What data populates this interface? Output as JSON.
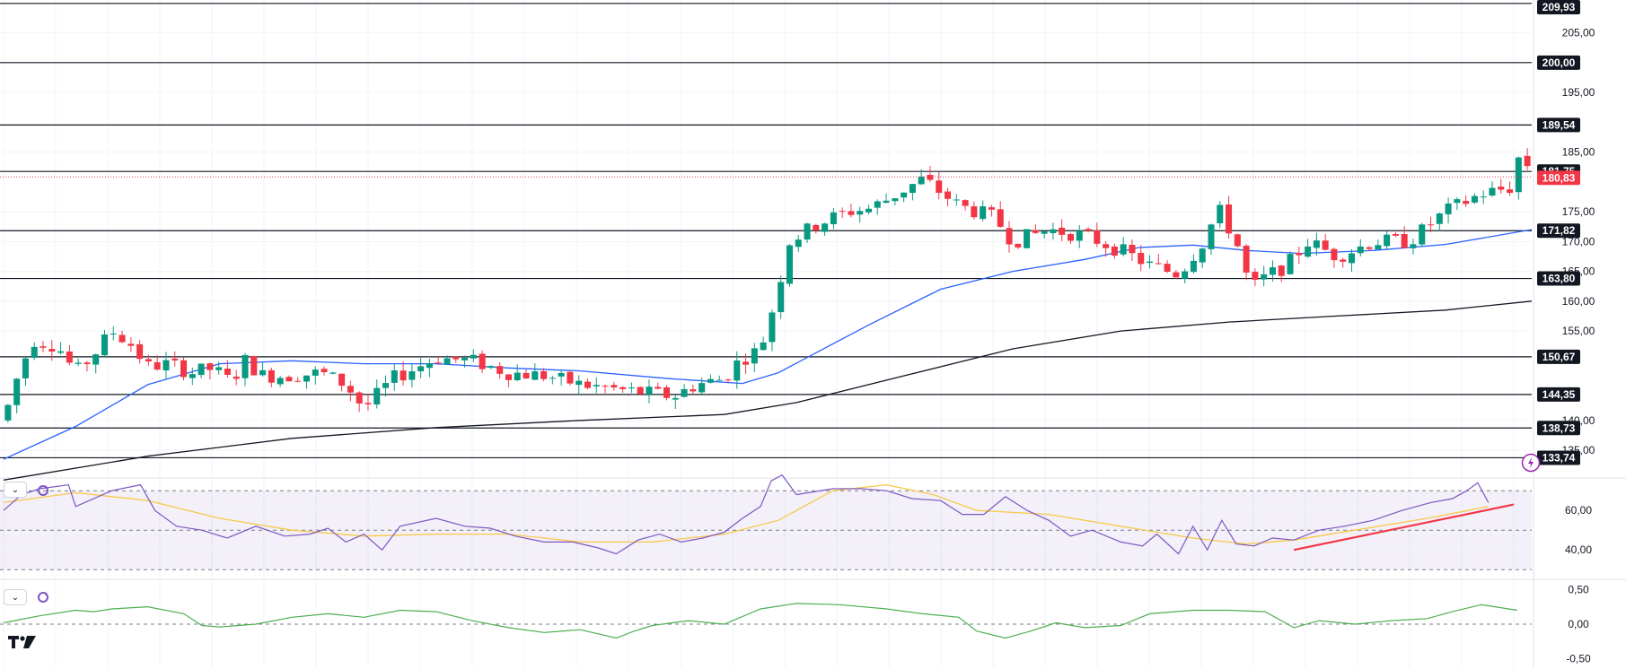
{
  "colors": {
    "bull": "#089981",
    "bear": "#f23645",
    "ema50": "#2962ff",
    "ema200": "#131722",
    "rsi": "#7e57c2",
    "rsi_ma": "#f7c948",
    "rsi_band": "#7e57c2",
    "cmf": "#4caf50",
    "trendline": "#f23645",
    "last_price": "#f23645"
  },
  "icons": [
    "chevron-down-icon",
    "refresh-icon",
    "lightning-icon",
    "tradingview-logo"
  ],
  "chart_data": [
    {
      "type": "candlestick",
      "title": "",
      "y_axis_side": "right",
      "ylim": [
        130.5,
        210.5
      ],
      "ticks": [
        "205,00",
        "195,00",
        "185,00",
        "175,00",
        "170,00",
        "165,00",
        "160,00",
        "155,00",
        "140,00",
        "135,00"
      ],
      "tick_values": [
        205,
        195,
        185,
        175,
        170,
        165,
        160,
        155,
        140,
        135
      ],
      "horizontal_levels": [
        {
          "value": 209.93,
          "label": "209,93"
        },
        {
          "value": 200.0,
          "label": "200,00"
        },
        {
          "value": 189.54,
          "label": "189,54"
        },
        {
          "value": 181.75,
          "label": "181,75"
        },
        {
          "value": 171.82,
          "label": "171,82"
        },
        {
          "value": 163.8,
          "label": "163,80"
        },
        {
          "value": 150.67,
          "label": "150,67"
        },
        {
          "value": 144.35,
          "label": "144,35"
        },
        {
          "value": 138.73,
          "label": "138,73"
        },
        {
          "value": 133.74,
          "label": "133,74"
        }
      ],
      "last_price": {
        "value": 180.83,
        "label": "180,83"
      },
      "candle_count": 174,
      "close_path": [
        [
          0,
          140
        ],
        [
          3,
          146
        ],
        [
          8,
          153.5
        ],
        [
          15,
          152.5
        ],
        [
          20,
          148
        ],
        [
          25,
          151
        ],
        [
          30,
          155
        ],
        [
          35,
          153
        ],
        [
          40,
          149
        ],
        [
          46,
          149.5
        ],
        [
          52,
          148
        ],
        [
          58,
          148.7
        ],
        [
          63,
          146.5
        ],
        [
          67,
          150
        ],
        [
          72,
          147.5
        ],
        [
          80,
          147.5
        ],
        [
          88,
          148
        ],
        [
          95,
          146
        ],
        [
          100,
          142
        ],
        [
          108,
          147
        ],
        [
          115,
          149
        ],
        [
          120,
          150.5
        ],
        [
          130,
          150
        ],
        [
          140,
          148
        ],
        [
          150,
          147.5
        ],
        [
          160,
          146
        ],
        [
          170,
          145.2
        ],
        [
          180,
          144.5
        ],
        [
          186,
          144
        ],
        [
          192,
          146
        ],
        [
          200,
          147
        ],
        [
          204,
          150
        ],
        [
          210,
          152
        ],
        [
          214,
          160
        ],
        [
          218,
          170
        ],
        [
          226,
          173
        ],
        [
          234,
          175
        ],
        [
          240,
          175.5
        ],
        [
          245,
          177
        ],
        [
          255,
          180.5
        ],
        [
          265,
          176
        ],
        [
          275,
          174
        ],
        [
          280,
          170
        ],
        [
          290,
          172
        ],
        [
          300,
          171
        ],
        [
          310,
          168.5
        ],
        [
          318,
          166
        ],
        [
          326,
          164.5
        ],
        [
          333,
          170
        ],
        [
          337,
          175.5
        ],
        [
          342,
          170
        ],
        [
          346,
          162
        ],
        [
          350,
          164
        ],
        [
          356,
          166
        ],
        [
          362,
          170
        ],
        [
          370,
          167.5
        ],
        [
          380,
          170
        ],
        [
          390,
          170
        ],
        [
          400,
          175
        ],
        [
          410,
          178
        ],
        [
          418,
          179
        ],
        [
          421,
          185.4
        ],
        [
          424,
          181.2
        ]
      ],
      "ema50_path": [
        [
          0,
          133.5
        ],
        [
          20,
          139
        ],
        [
          40,
          146
        ],
        [
          60,
          149.5
        ],
        [
          80,
          150
        ],
        [
          100,
          149.5
        ],
        [
          120,
          149.5
        ],
        [
          140,
          148.8
        ],
        [
          160,
          148.3
        ],
        [
          185,
          147
        ],
        [
          205,
          146.2
        ],
        [
          215,
          148
        ],
        [
          240,
          156
        ],
        [
          260,
          162
        ],
        [
          280,
          165
        ],
        [
          300,
          167
        ],
        [
          315,
          169
        ],
        [
          330,
          169.4
        ],
        [
          345,
          168.5
        ],
        [
          360,
          168
        ],
        [
          380,
          168.5
        ],
        [
          400,
          169.5
        ],
        [
          424,
          172
        ]
      ],
      "ema200_path": [
        [
          0,
          130
        ],
        [
          40,
          134
        ],
        [
          80,
          137
        ],
        [
          120,
          138.8
        ],
        [
          160,
          140
        ],
        [
          200,
          141
        ],
        [
          220,
          143
        ],
        [
          250,
          147.5
        ],
        [
          280,
          152
        ],
        [
          310,
          155
        ],
        [
          340,
          156.5
        ],
        [
          370,
          157.5
        ],
        [
          400,
          158.5
        ],
        [
          424,
          160
        ]
      ]
    },
    {
      "type": "line",
      "title": "",
      "ylim": [
        26,
        76
      ],
      "ticks": [
        "60,00",
        "40,00"
      ],
      "tick_values": [
        60,
        40
      ],
      "bands": [
        {
          "value": 70
        },
        {
          "value": 50
        },
        {
          "value": 30
        }
      ],
      "rsi_path": [
        [
          0,
          60
        ],
        [
          5,
          68
        ],
        [
          10,
          71
        ],
        [
          18,
          73
        ],
        [
          20,
          62
        ],
        [
          30,
          70
        ],
        [
          38,
          73
        ],
        [
          42,
          60
        ],
        [
          48,
          52
        ],
        [
          55,
          50
        ],
        [
          62,
          46
        ],
        [
          70,
          52
        ],
        [
          78,
          47
        ],
        [
          85,
          48
        ],
        [
          90,
          51
        ],
        [
          95,
          44
        ],
        [
          100,
          48
        ],
        [
          105,
          40
        ],
        [
          110,
          52
        ],
        [
          120,
          56
        ],
        [
          128,
          52
        ],
        [
          135,
          51
        ],
        [
          142,
          47
        ],
        [
          150,
          44
        ],
        [
          158,
          44
        ],
        [
          165,
          41
        ],
        [
          170,
          38
        ],
        [
          176,
          45
        ],
        [
          182,
          48
        ],
        [
          188,
          44
        ],
        [
          194,
          46
        ],
        [
          200,
          49
        ],
        [
          205,
          56
        ],
        [
          210,
          62
        ],
        [
          213,
          75
        ],
        [
          216,
          78
        ],
        [
          220,
          68
        ],
        [
          230,
          71
        ],
        [
          238,
          71
        ],
        [
          245,
          70
        ],
        [
          252,
          66
        ],
        [
          260,
          65
        ],
        [
          266,
          58
        ],
        [
          272,
          58
        ],
        [
          278,
          67
        ],
        [
          284,
          60
        ],
        [
          290,
          55
        ],
        [
          296,
          47
        ],
        [
          302,
          50
        ],
        [
          310,
          44
        ],
        [
          316,
          42
        ],
        [
          320,
          48
        ],
        [
          326,
          38
        ],
        [
          330,
          52
        ],
        [
          334,
          40
        ],
        [
          338,
          55
        ],
        [
          342,
          43
        ],
        [
          347,
          42
        ],
        [
          352,
          46
        ],
        [
          358,
          45
        ],
        [
          365,
          50
        ],
        [
          372,
          52
        ],
        [
          380,
          55
        ],
        [
          388,
          60
        ],
        [
          396,
          64
        ],
        [
          402,
          66
        ],
        [
          406,
          70
        ],
        [
          409,
          74
        ],
        [
          412,
          64
        ]
      ],
      "rsi_ma_path": [
        [
          0,
          64
        ],
        [
          20,
          69
        ],
        [
          40,
          65
        ],
        [
          60,
          56
        ],
        [
          80,
          50
        ],
        [
          100,
          47
        ],
        [
          120,
          48
        ],
        [
          140,
          48
        ],
        [
          160,
          44
        ],
        [
          180,
          44
        ],
        [
          200,
          48
        ],
        [
          215,
          55
        ],
        [
          230,
          70
        ],
        [
          245,
          73
        ],
        [
          258,
          68
        ],
        [
          270,
          60
        ],
        [
          290,
          58
        ],
        [
          310,
          52
        ],
        [
          330,
          46
        ],
        [
          345,
          43
        ],
        [
          358,
          45
        ],
        [
          375,
          50
        ],
        [
          395,
          56
        ],
        [
          412,
          62
        ]
      ],
      "trendline": [
        [
          358,
          40
        ],
        [
          419,
          63
        ]
      ]
    },
    {
      "type": "line",
      "title": "",
      "ylim": [
        -0.62,
        0.62
      ],
      "ticks": [
        "0,50",
        "0,00",
        "-0,50"
      ],
      "tick_values": [
        0.5,
        0.0,
        -0.5
      ],
      "zero_line": 0,
      "cmf_path": [
        [
          0,
          0.02
        ],
        [
          10,
          0.12
        ],
        [
          20,
          0.2
        ],
        [
          25,
          0.18
        ],
        [
          30,
          0.22
        ],
        [
          40,
          0.25
        ],
        [
          50,
          0.15
        ],
        [
          55,
          -0.02
        ],
        [
          60,
          -0.04
        ],
        [
          70,
          0.0
        ],
        [
          80,
          0.1
        ],
        [
          90,
          0.15
        ],
        [
          100,
          0.1
        ],
        [
          110,
          0.2
        ],
        [
          120,
          0.18
        ],
        [
          130,
          0.05
        ],
        [
          140,
          -0.05
        ],
        [
          150,
          -0.12
        ],
        [
          160,
          -0.08
        ],
        [
          170,
          -0.2
        ],
        [
          175,
          -0.1
        ],
        [
          180,
          -0.02
        ],
        [
          190,
          0.05
        ],
        [
          200,
          0.0
        ],
        [
          210,
          0.22
        ],
        [
          220,
          0.3
        ],
        [
          232,
          0.28
        ],
        [
          245,
          0.22
        ],
        [
          255,
          0.15
        ],
        [
          265,
          0.1
        ],
        [
          270,
          -0.1
        ],
        [
          278,
          -0.2
        ],
        [
          285,
          -0.1
        ],
        [
          292,
          0.02
        ],
        [
          300,
          -0.05
        ],
        [
          310,
          -0.02
        ],
        [
          318,
          0.15
        ],
        [
          330,
          0.2
        ],
        [
          340,
          0.2
        ],
        [
          350,
          0.18
        ],
        [
          358,
          -0.05
        ],
        [
          365,
          0.05
        ],
        [
          375,
          0.0
        ],
        [
          385,
          0.05
        ],
        [
          395,
          0.08
        ],
        [
          402,
          0.18
        ],
        [
          410,
          0.28
        ],
        [
          420,
          0.2
        ]
      ]
    }
  ]
}
